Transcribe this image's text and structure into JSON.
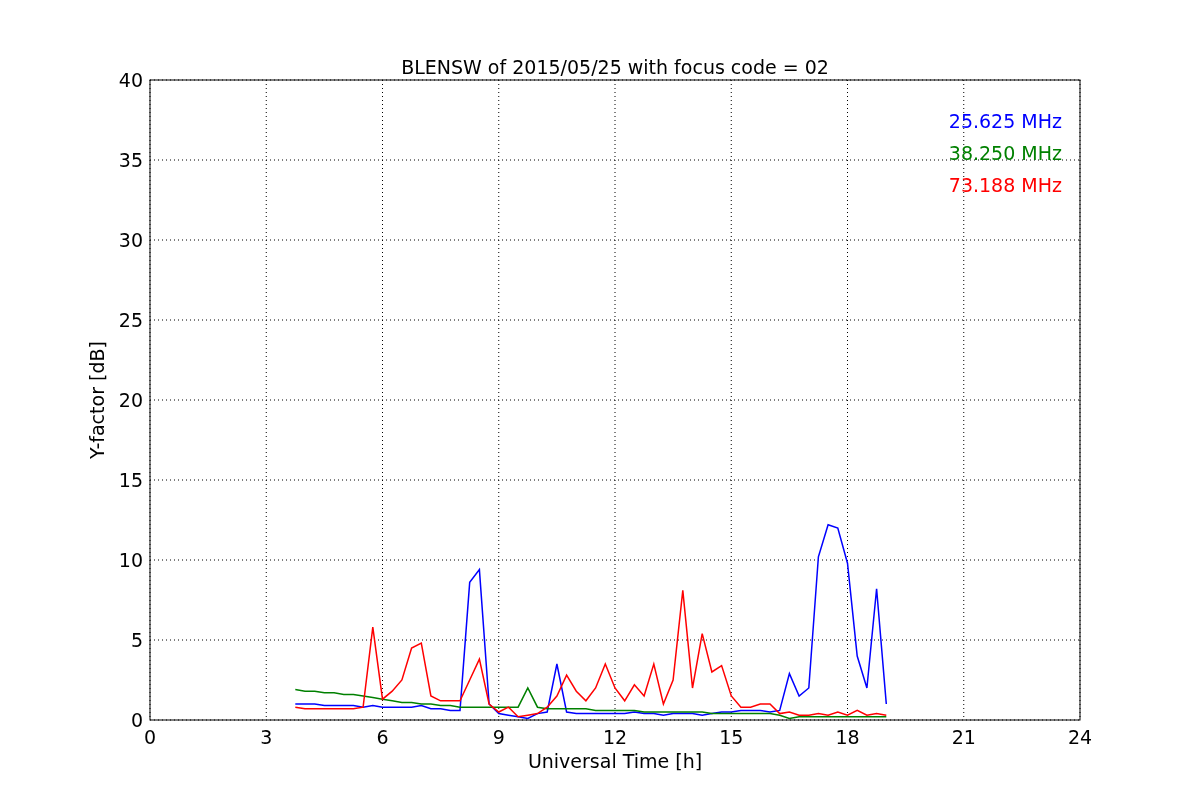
{
  "chart_data": {
    "type": "line",
    "title": "BLENSW of 2015/05/25 with focus code = 02",
    "xlabel": "Universal Time [h]",
    "ylabel": "Y-factor [dB]",
    "x": [
      3.75,
      4,
      4.25,
      4.5,
      4.75,
      5,
      5.25,
      5.5,
      5.75,
      6,
      6.25,
      6.5,
      6.75,
      7,
      7.25,
      7.5,
      7.75,
      8,
      8.25,
      8.5,
      8.75,
      9,
      9.25,
      9.5,
      9.75,
      10,
      10.25,
      10.5,
      10.75,
      11,
      11.25,
      11.5,
      11.75,
      12,
      12.25,
      12.5,
      12.75,
      13,
      13.25,
      13.5,
      13.75,
      14,
      14.25,
      14.5,
      14.75,
      15,
      15.25,
      15.5,
      15.75,
      16,
      16.25,
      16.5,
      16.75,
      17,
      17.25,
      17.5,
      17.75,
      18,
      18.25,
      18.5,
      18.75,
      19
    ],
    "series": [
      {
        "name": "25.625 MHz",
        "color": "#0000ff",
        "values": [
          1.0,
          1.0,
          1.0,
          0.9,
          0.9,
          0.9,
          0.9,
          0.8,
          0.9,
          0.8,
          0.8,
          0.8,
          0.8,
          0.9,
          0.7,
          0.7,
          0.6,
          0.6,
          8.6,
          9.4,
          1.0,
          0.4,
          0.3,
          0.2,
          0.1,
          0.4,
          0.5,
          3.5,
          0.5,
          0.4,
          0.4,
          0.4,
          0.4,
          0.4,
          0.4,
          0.5,
          0.4,
          0.4,
          0.3,
          0.4,
          0.4,
          0.4,
          0.3,
          0.4,
          0.5,
          0.5,
          0.6,
          0.6,
          0.6,
          0.5,
          0.6,
          2.9,
          1.5,
          2.0,
          10.2,
          12.2,
          12.0,
          9.8,
          4.0,
          2.0,
          8.2,
          1.0
        ]
      },
      {
        "name": "38.250 MHz",
        "color": "#008000",
        "values": [
          1.9,
          1.8,
          1.8,
          1.7,
          1.7,
          1.6,
          1.6,
          1.5,
          1.4,
          1.3,
          1.2,
          1.1,
          1.1,
          1.0,
          1.0,
          0.9,
          0.9,
          0.8,
          0.8,
          0.8,
          0.8,
          0.8,
          0.8,
          0.8,
          2.0,
          0.8,
          0.7,
          0.7,
          0.7,
          0.7,
          0.7,
          0.6,
          0.6,
          0.6,
          0.6,
          0.6,
          0.5,
          0.5,
          0.5,
          0.5,
          0.5,
          0.5,
          0.5,
          0.4,
          0.4,
          0.4,
          0.4,
          0.4,
          0.4,
          0.4,
          0.3,
          0.1,
          0.2,
          0.2,
          0.2,
          0.2,
          0.2,
          0.2,
          0.2,
          0.2,
          0.2,
          0.2
        ]
      },
      {
        "name": "73.188 MHz",
        "color": "#ff0000",
        "values": [
          0.8,
          0.7,
          0.7,
          0.7,
          0.7,
          0.7,
          0.7,
          0.8,
          5.8,
          1.3,
          1.8,
          2.5,
          4.5,
          4.8,
          1.5,
          1.2,
          1.2,
          1.2,
          2.5,
          3.8,
          1.0,
          0.5,
          0.8,
          0.2,
          0.3,
          0.4,
          0.8,
          1.5,
          2.8,
          1.8,
          1.2,
          2.0,
          3.5,
          2.0,
          1.2,
          2.2,
          1.5,
          3.5,
          1.0,
          2.5,
          8.1,
          2.0,
          5.4,
          3.0,
          3.4,
          1.5,
          0.8,
          0.8,
          1.0,
          1.0,
          0.4,
          0.5,
          0.3,
          0.3,
          0.4,
          0.3,
          0.5,
          0.3,
          0.6,
          0.3,
          0.4,
          0.3
        ]
      }
    ],
    "xlim": [
      0,
      24
    ],
    "ylim": [
      0,
      40
    ],
    "xticks": [
      0,
      3,
      6,
      9,
      12,
      15,
      18,
      21,
      24
    ],
    "yticks": [
      0,
      5,
      10,
      15,
      20,
      25,
      30,
      35,
      40
    ],
    "grid": true
  }
}
